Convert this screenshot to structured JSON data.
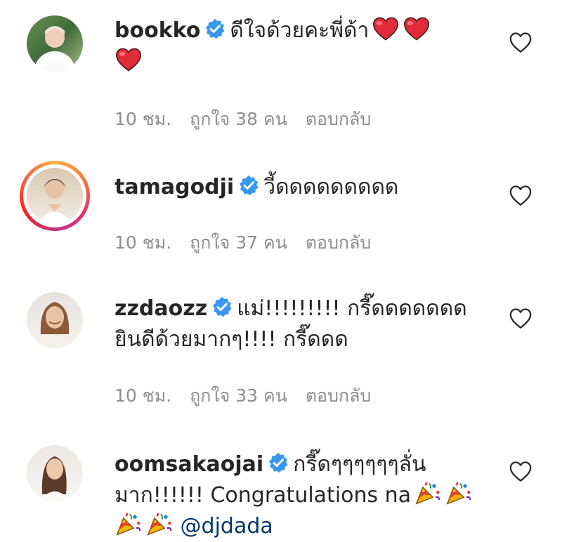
{
  "comments": [
    {
      "username": "bookko",
      "text": "ดีใจด้วยคะพี่ด้า",
      "time": "10 ชม.",
      "likes": "ถูกใจ 38 คน",
      "reply": "ตอบกลับ"
    },
    {
      "username": "tamagodji",
      "text": "วี้ดดดดดดดดด",
      "time": "10 ชม.",
      "likes": "ถูกใจ 37 คน",
      "reply": "ตอบกลับ"
    },
    {
      "username": "zzdaozz",
      "text": "แม่!!!!!!!!! กรี๊ดดดดดดด ยินดีด้วยมากๆ!!!! กรี๊ดดด",
      "time": "10 ชม.",
      "likes": "ถูกใจ 33 คน",
      "reply": "ตอบกลับ"
    },
    {
      "username": "oomsakaojai",
      "text": "กรี๊ดๆๆๆๆๆๆลั่น มาก!!!!!! Congratulations na",
      "mention": "@djdada",
      "time": "",
      "likes": "",
      "reply": ""
    }
  ],
  "icons": {
    "verified": "verified-badge-icon",
    "like": "heart-outline-icon",
    "emoji_heart": "red-heart-emoji",
    "emoji_party": "party-popper-emoji"
  },
  "colors": {
    "verified": "#3897f0",
    "meta_text": "#8e8e8e",
    "mention": "#00376b"
  }
}
